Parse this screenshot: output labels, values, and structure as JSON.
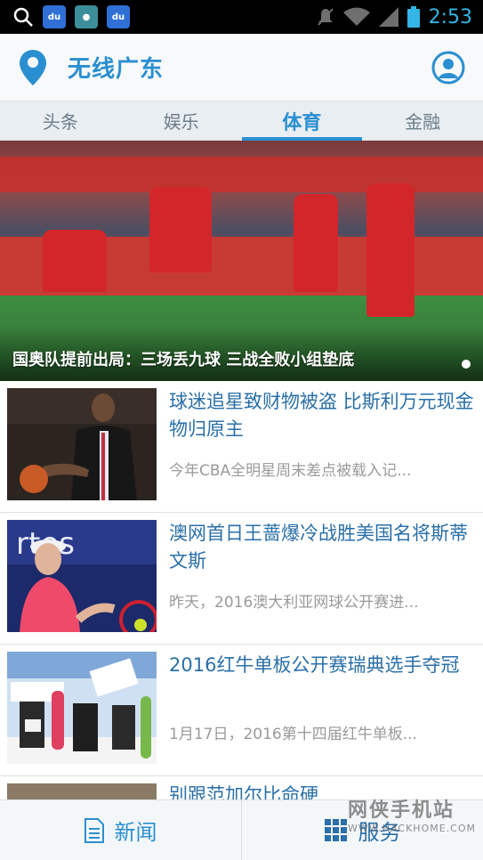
{
  "status_bar": {
    "time": "2:53",
    "notification_icons": [
      "search-icon",
      "baidu-icon",
      "app-icon",
      "baidu-icon"
    ],
    "system_icons": [
      "mute-icon",
      "wifi-icon",
      "signal-icon",
      "battery-icon"
    ]
  },
  "header": {
    "title": "无线广东"
  },
  "tabs": [
    {
      "label": "头条",
      "active": false
    },
    {
      "label": "娱乐",
      "active": false
    },
    {
      "label": "体育",
      "active": true
    },
    {
      "label": "金融",
      "active": false
    }
  ],
  "hero": {
    "caption": "国奥队提前出局：三场丢九球 三战全败小组垫底"
  },
  "news": [
    {
      "title": "球迷追星致财物被盗 比斯利万元现金物归原主",
      "summary": "今年CBA全明星周末差点被载入记..."
    },
    {
      "title": "澳网首日王蔷爆冷战胜美国名将斯蒂文斯",
      "summary": "昨天，2016澳大利亚网球公开赛进..."
    },
    {
      "title": "2016红牛单板公开赛瑞典选手夺冠",
      "summary": "1月17日，2016第十四届红牛单板..."
    }
  ],
  "partial_news_title": "别跟范加尔比命硬",
  "bottom_nav": {
    "news_label": "新闻",
    "services_label": "服务"
  },
  "watermark": {
    "text": "网侠手机站",
    "url": "WWW.HACKHOME.COM"
  },
  "colors": {
    "accent": "#2a8fd0",
    "title_blue": "#2a6fa8",
    "summary_gray": "#9a9a9a"
  }
}
